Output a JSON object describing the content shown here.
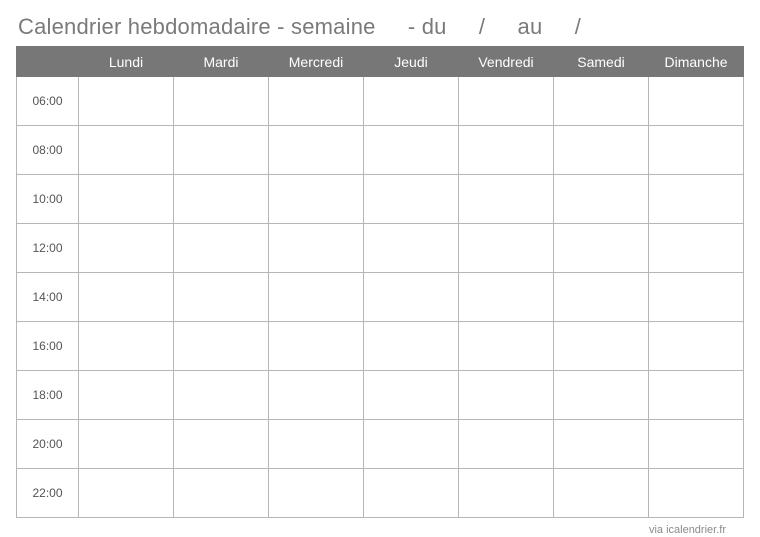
{
  "title": {
    "prefix": "Calendrier hebdomadaire - semaine",
    "dash": "- du",
    "slash1": "/",
    "au": "au",
    "slash2": "/"
  },
  "days": [
    "Lundi",
    "Mardi",
    "Mercredi",
    "Jeudi",
    "Vendredi",
    "Samedi",
    "Dimanche"
  ],
  "times": [
    "06:00",
    "08:00",
    "10:00",
    "12:00",
    "14:00",
    "16:00",
    "18:00",
    "20:00",
    "22:00"
  ],
  "footer": "via icalendrier.fr"
}
